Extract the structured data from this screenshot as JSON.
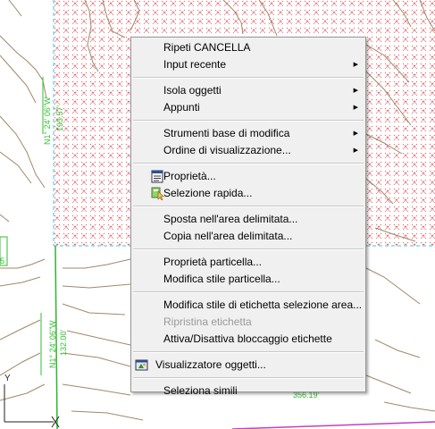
{
  "drawing": {
    "bearing_top": "N1° 24' 06\"W",
    "dist_top": "193.57'",
    "bearing_mid": "N1° 24' 06\"W",
    "dist_mid": "132.00'",
    "dist_bottom": "356.19'",
    "ucs_label": "Y",
    "label_5": "5"
  },
  "menu": {
    "items": [
      {
        "label": "Ripeti CANCELLA"
      },
      {
        "label": "Input recente",
        "submenu": true
      },
      {
        "label": "Isola oggetti",
        "submenu": true
      },
      {
        "label": "Appunti",
        "submenu": true
      },
      {
        "label": "Strumenti base di modifica",
        "submenu": true
      },
      {
        "label": "Ordine di visualizzazione...",
        "submenu": true
      },
      {
        "label": "Proprietà...",
        "icon": "properties-icon"
      },
      {
        "label": "Selezione rapida...",
        "icon": "quick-select-icon"
      },
      {
        "label": "Sposta nell'area delimitata..."
      },
      {
        "label": "Copia nell'area delimitata..."
      },
      {
        "label": "Proprietà particella..."
      },
      {
        "label": "Modifica stile particella..."
      },
      {
        "label": "Modifica stile di etichetta selezione area..."
      },
      {
        "label": "Ripristina etichetta",
        "disabled": true
      },
      {
        "label": "Attiva/Disattiva bloccaggio etichette"
      },
      {
        "label": "Visualizzatore oggetti...",
        "icon": "object-viewer-icon"
      },
      {
        "label": "Seleziona simili"
      }
    ],
    "submenu_arrow": "▶"
  }
}
